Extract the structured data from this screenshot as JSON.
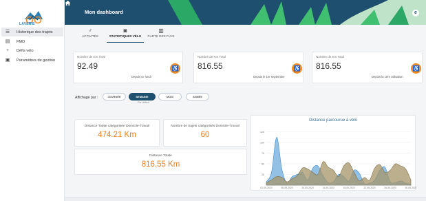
{
  "app": {
    "logo_text": "LAVERIE",
    "title": "Mon dashboard",
    "user_initial": "e"
  },
  "sidebar": {
    "items": [
      {
        "label": "Historique des trajets",
        "icon": "list-icon",
        "active": true
      },
      {
        "label": "FMD",
        "icon": "document-icon",
        "active": false
      },
      {
        "label": "Défis vélo",
        "icon": "trophy-icon",
        "active": false
      },
      {
        "label": "Paramètres de gestion",
        "icon": "settings-icon",
        "active": false
      }
    ]
  },
  "tabs": [
    {
      "label": "ACTIVITÉS",
      "icon": "bike-icon",
      "active": false
    },
    {
      "label": "STATISTIQUES VÉLO",
      "icon": "chart-icon",
      "active": true
    },
    {
      "label": "CARTE DES FLUX",
      "icon": "map-icon",
      "active": false
    }
  ],
  "stats": [
    {
      "title": "Nombre de Km Total",
      "value": "92.49",
      "sub": "Depuis ce lundi"
    },
    {
      "title": "Nombre de Km Total",
      "value": "816.55",
      "sub": "Depuis le 1er septembre"
    },
    {
      "title": "Nombre de Km Total",
      "value": "816.55",
      "sub": "Depuis la 1ère utilisation"
    }
  ],
  "filter": {
    "label": "Affichage par :",
    "options": [
      "JOURNÉE",
      "SEMAINE",
      "MOIS",
      "ANNÉE"
    ],
    "selected": "SEMAINE",
    "note": "Par défaut"
  },
  "kpis": {
    "distance_dt_title": "Distance Totale catégorisée Domicile-Travail",
    "distance_dt_value": "474.21 Km",
    "trips_dt_title": "Nombre de trajets catégorisés Domicile-Travail",
    "trips_dt_value": "60",
    "distance_total_title": "Distance Totale",
    "distance_total_value": "816.55 Km"
  },
  "colors": {
    "topbar": "#1f4f6e",
    "accent": "#f08a24",
    "series_blue": "#7fb6e0",
    "series_olive": "#a69468"
  },
  "chart_data": {
    "type": "area",
    "title": "Distance parcourue à vélo",
    "xlabel": "",
    "ylabel": "",
    "ylim": [
      0,
      140
    ],
    "yticks": [
      25,
      50,
      75,
      100,
      125
    ],
    "ytick_labels": [
      "25",
      "50",
      "75",
      "100",
      "125"
    ],
    "x_tick_labels": [
      "02-09-2020",
      "06-09-2020",
      "10-09-2020",
      "14-09-2020",
      "18-09-2020",
      "22-09-2020",
      "26-09-2020",
      "30-09-2020"
    ],
    "x": [
      0,
      1,
      2,
      3,
      4,
      5,
      6,
      7,
      8,
      9,
      10,
      11,
      12,
      13,
      14,
      15,
      16,
      17,
      18,
      19,
      20,
      21,
      22,
      23,
      24,
      25,
      26,
      27,
      28
    ],
    "series": [
      {
        "name": "",
        "values": [
          8,
          30,
          112,
          38,
          5,
          20,
          25,
          30,
          12,
          40,
          45,
          22,
          6,
          8,
          25,
          20,
          10,
          35,
          28,
          4,
          5,
          12,
          35,
          42,
          8,
          6,
          10,
          5,
          2
        ]
      },
      {
        "name": "",
        "values": [
          6,
          12,
          20,
          18,
          8,
          15,
          22,
          40,
          38,
          30,
          25,
          55,
          42,
          35,
          20,
          45,
          52,
          30,
          10,
          18,
          12,
          40,
          48,
          30,
          35,
          50,
          45,
          38,
          12
        ]
      }
    ]
  }
}
